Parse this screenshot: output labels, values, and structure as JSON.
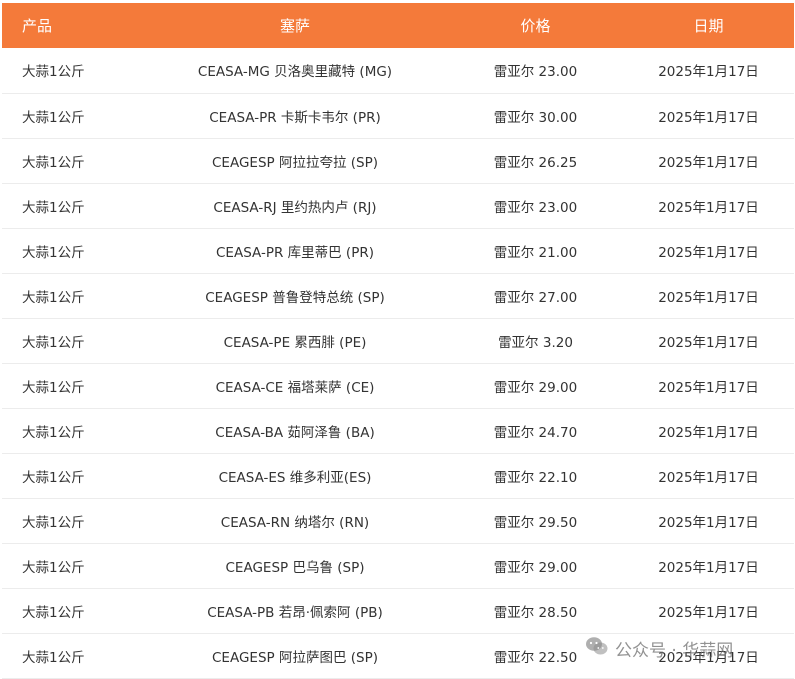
{
  "headers": {
    "product": "产品",
    "market": "塞萨",
    "price": "价格",
    "date": "日期"
  },
  "rows": [
    {
      "product": "大蒜1公斤",
      "market": "CEASA-MG 贝洛奥里藏特 (MG)",
      "price": "雷亚尔 23.00",
      "date": "2025年1月17日"
    },
    {
      "product": "大蒜1公斤",
      "market": "CEASA-PR 卡斯卡韦尔 (PR)",
      "price": "雷亚尔 30.00",
      "date": "2025年1月17日"
    },
    {
      "product": "大蒜1公斤",
      "market": "CEAGESP 阿拉拉夸拉 (SP)",
      "price": "雷亚尔 26.25",
      "date": "2025年1月17日"
    },
    {
      "product": "大蒜1公斤",
      "market": "CEASA-RJ 里约热内卢 (RJ)",
      "price": "雷亚尔 23.00",
      "date": "2025年1月17日"
    },
    {
      "product": "大蒜1公斤",
      "market": "CEASA-PR 库里蒂巴 (PR)",
      "price": "雷亚尔 21.00",
      "date": "2025年1月17日"
    },
    {
      "product": "大蒜1公斤",
      "market": "CEAGESP 普鲁登特总统 (SP)",
      "price": "雷亚尔 27.00",
      "date": "2025年1月17日"
    },
    {
      "product": "大蒜1公斤",
      "market": "CEASA-PE 累西腓 (PE)",
      "price": "雷亚尔 3.20",
      "date": "2025年1月17日"
    },
    {
      "product": "大蒜1公斤",
      "market": "CEASA-CE 福塔莱萨 (CE)",
      "price": "雷亚尔 29.00",
      "date": "2025年1月17日"
    },
    {
      "product": "大蒜1公斤",
      "market": "CEASA-BA 茹阿泽鲁 (BA)",
      "price": "雷亚尔 24.70",
      "date": "2025年1月17日"
    },
    {
      "product": "大蒜1公斤",
      "market": "CEASA-ES 维多利亚(ES)",
      "price": "雷亚尔 22.10",
      "date": "2025年1月17日"
    },
    {
      "product": "大蒜1公斤",
      "market": "CEASA-RN 纳塔尔 (RN)",
      "price": "雷亚尔 29.50",
      "date": "2025年1月17日"
    },
    {
      "product": "大蒜1公斤",
      "market": "CEAGESP 巴乌鲁 (SP)",
      "price": "雷亚尔 29.00",
      "date": "2025年1月17日"
    },
    {
      "product": "大蒜1公斤",
      "market": "CEASA-PB 若昂·佩索阿 (PB)",
      "price": "雷亚尔 28.50",
      "date": "2025年1月17日"
    },
    {
      "product": "大蒜1公斤",
      "market": "CEAGESP 阿拉萨图巴 (SP)",
      "price": "雷亚尔 22.50",
      "date": "2025年1月17日"
    }
  ],
  "watermark": {
    "text": "公众号 · 华蒜网",
    "icon": "wechat-icon"
  },
  "colors": {
    "header_bg": "#f47a3a",
    "header_text": "#ffffff",
    "row_text": "#333333",
    "row_divider": "#ececec"
  }
}
